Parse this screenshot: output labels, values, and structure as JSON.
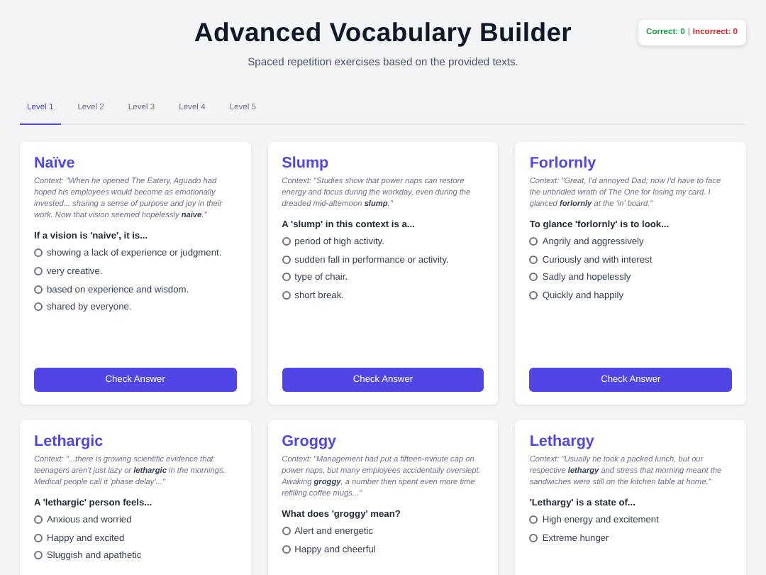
{
  "header": {
    "title": "Advanced Vocabulary Builder",
    "subtitle": "Spaced repetition exercises based on the provided texts.",
    "score": {
      "correct": "Correct: 0",
      "separator": "|",
      "incorrect": "Incorrect: 0"
    }
  },
  "tabs": [
    {
      "label": "Level 1",
      "selected": true
    },
    {
      "label": "Level 2",
      "selected": false
    },
    {
      "label": "Level 3",
      "selected": false
    },
    {
      "label": "Level 4",
      "selected": false
    },
    {
      "label": "Level 5",
      "selected": false
    }
  ],
  "cards": [
    {
      "word": "Naïve",
      "context": "Context: \"When he opened The Eatery, Aguado had hoped his employees would become as emotionally invested... sharing a sense of purpose and joy in their work. Now that vision seemed hopelessly **naive**.\"",
      "question": "If a vision is 'naive', it is...",
      "options": [
        {
          "label": "showing a lack of experience or judgment.",
          "selected": false
        },
        {
          "label": "very creative.",
          "selected": false
        },
        {
          "label": "based on experience and wisdom.",
          "selected": false
        },
        {
          "label": "shared by everyone.",
          "selected": false
        }
      ],
      "button": "Check Answer"
    },
    {
      "word": "Slump",
      "context": "Context: \"Studies show that power naps can restore energy and focus during the workday, even during the dreaded mid-afternoon **slump**.\"",
      "question": "A 'slump' in this context is a...",
      "options": [
        {
          "label": "period of high activity.",
          "selected": false
        },
        {
          "label": "sudden fall in performance or activity.",
          "selected": false
        },
        {
          "label": "type of chair.",
          "selected": false
        },
        {
          "label": "short break.",
          "selected": false
        }
      ],
      "button": "Check Answer"
    },
    {
      "word": "Forlornly",
      "context": "Context: \"Great, I'd annoyed Dad; now I'd have to face the unbridled wrath of The One for losing my card. I glanced **forlornly** at the 'in' board.\"",
      "question": "To glance 'forlornly' is to look...",
      "options": [
        {
          "label": "Angrily and aggressively",
          "selected": false
        },
        {
          "label": "Curiously and with interest",
          "selected": false
        },
        {
          "label": "Sadly and hopelessly",
          "selected": false
        },
        {
          "label": "Quickly and happily",
          "selected": false
        }
      ],
      "button": "Check Answer"
    },
    {
      "word": "Lethargic",
      "context": "Context: \"...there is growing scientific evidence that teenagers aren't just lazy or **lethargic** in the mornings. Medical people call it 'phase delay'...\"",
      "question": "A 'lethargic' person feels...",
      "options": [
        {
          "label": "Anxious and worried",
          "selected": false
        },
        {
          "label": "Happy and excited",
          "selected": false
        },
        {
          "label": "Sluggish and apathetic",
          "selected": false
        }
      ]
    },
    {
      "word": "Groggy",
      "context": "Context: \"Management had put a fifteen-minute cap on power naps, but many employees accidentally overslept. Awaking **groggy**, a number then spent even more time refilling coffee mugs...\"",
      "question": "What does 'groggy' mean?",
      "options": [
        {
          "label": "Alert and energetic",
          "selected": false
        },
        {
          "label": "Happy and cheerful",
          "selected": false
        }
      ]
    },
    {
      "word": "Lethargy",
      "context": "Context: \"Usually he took a packed lunch, but our respective **lethargy** and stress that morning meant the sandwiches were still on the kitchen table at home.\"",
      "question": "'Lethargy' is a state of...",
      "options": [
        {
          "label": "High energy and excitement",
          "selected": false
        },
        {
          "label": "Extreme hunger",
          "selected": false
        }
      ]
    }
  ]
}
